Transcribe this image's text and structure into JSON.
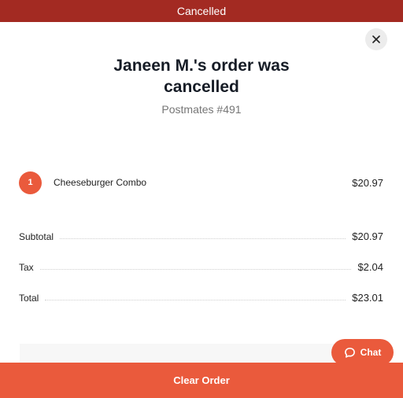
{
  "banner": {
    "status": "Cancelled"
  },
  "close_icon": "close-icon",
  "order": {
    "title_line1": "Janeen M.'s order was",
    "title_line2": "cancelled",
    "subtitle": "Postmates #491"
  },
  "items": [
    {
      "qty": "1",
      "name": "Cheeseburger Combo",
      "price": "$20.97"
    }
  ],
  "totals": {
    "subtotal_label": "Subtotal",
    "subtotal_value": "$20.97",
    "tax_label": "Tax",
    "tax_value": "$2.04",
    "total_label": "Total",
    "total_value": "$23.01"
  },
  "chat": {
    "label": "Chat",
    "icon": "chat-bubble-icon"
  },
  "footer": {
    "clear_order_label": "Clear Order"
  },
  "colors": {
    "banner": "#a32a22",
    "accent": "#ea5a3c",
    "title_text": "#161c26",
    "muted_text": "#767676"
  }
}
